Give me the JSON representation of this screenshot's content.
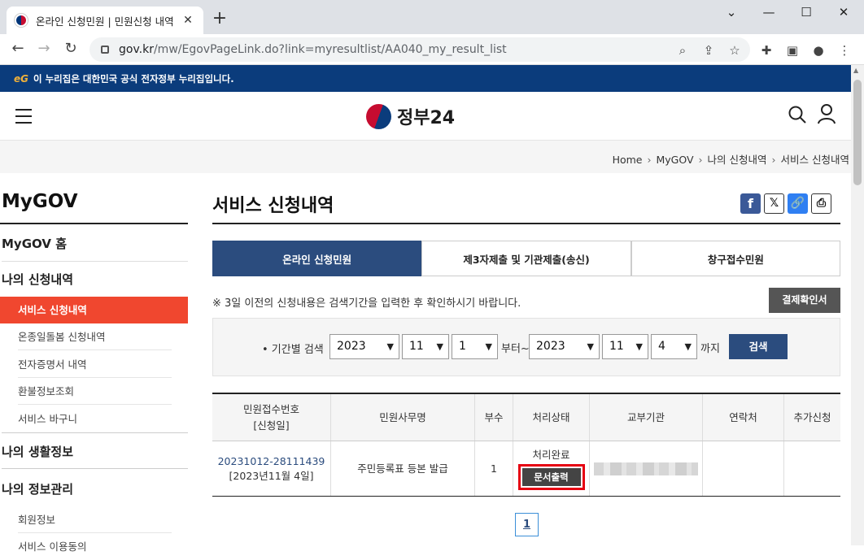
{
  "browser": {
    "tab_title": "온라인 신청민원 | 민원신청 내역",
    "url_host": "gov.kr",
    "url_path": "/mw/EgovPageLink.do?link=myresultlist/AA040_my_result_list"
  },
  "banner": {
    "logo": "eG",
    "text": "이 누리집은 대한민국 공식 전자정부 누리집입니다."
  },
  "header": {
    "logo_text": "정부24"
  },
  "breadcrumb": [
    "Home",
    "MyGOV",
    "나의 신청내역",
    "서비스 신청내역"
  ],
  "sidebar": {
    "title": "MyGOV",
    "home": "MyGOV 홈",
    "sections": [
      {
        "label": "나의 신청내역",
        "items": [
          "서비스 신청내역",
          "온종일돌봄 신청내역",
          "전자증명서 내역",
          "환불정보조회",
          "서비스 바구니"
        ]
      },
      {
        "label": "나의 생활정보"
      },
      {
        "label": "나의 정보관리",
        "items": [
          "회원정보",
          "서비스 이용동의"
        ]
      }
    ]
  },
  "main": {
    "title": "서비스 신청내역",
    "tabs": [
      "온라인 신청민원",
      "제3자제출 및 기관제출(송신)",
      "창구접수민원"
    ],
    "notice": "※ 3일 이전의 신청내용은 검색기간을 입력한 후 확인하시기 바랍니다.",
    "receipt_button": "결제확인서"
  },
  "filter": {
    "label": "• 기간별 검색",
    "from_year": "2023",
    "from_month": "11",
    "from_day": "1",
    "from_text": "부터~",
    "to_year": "2023",
    "to_month": "11",
    "to_day": "4",
    "to_text": "까지",
    "search_button": "검색"
  },
  "table": {
    "headers": [
      "민원접수번호\n[신청일]",
      "민원사무명",
      "부수",
      "처리상태",
      "교부기관",
      "연락처",
      "추가신청"
    ],
    "rows": [
      {
        "receipt_no": "20231012-28111439",
        "date": "[2023년11월 4일]",
        "name": "주민등록표 등본 발급",
        "copies": "1",
        "status": "처리완료",
        "print_button": "문서출력",
        "agency": "",
        "contact": "",
        "extra": ""
      }
    ]
  },
  "pagination": {
    "current": "1"
  },
  "colors": {
    "gov_navy": "#0b3c7c",
    "tab_active": "#2b4c7e",
    "sidebar_active": "#f0472f",
    "highlight": "#e60012"
  }
}
